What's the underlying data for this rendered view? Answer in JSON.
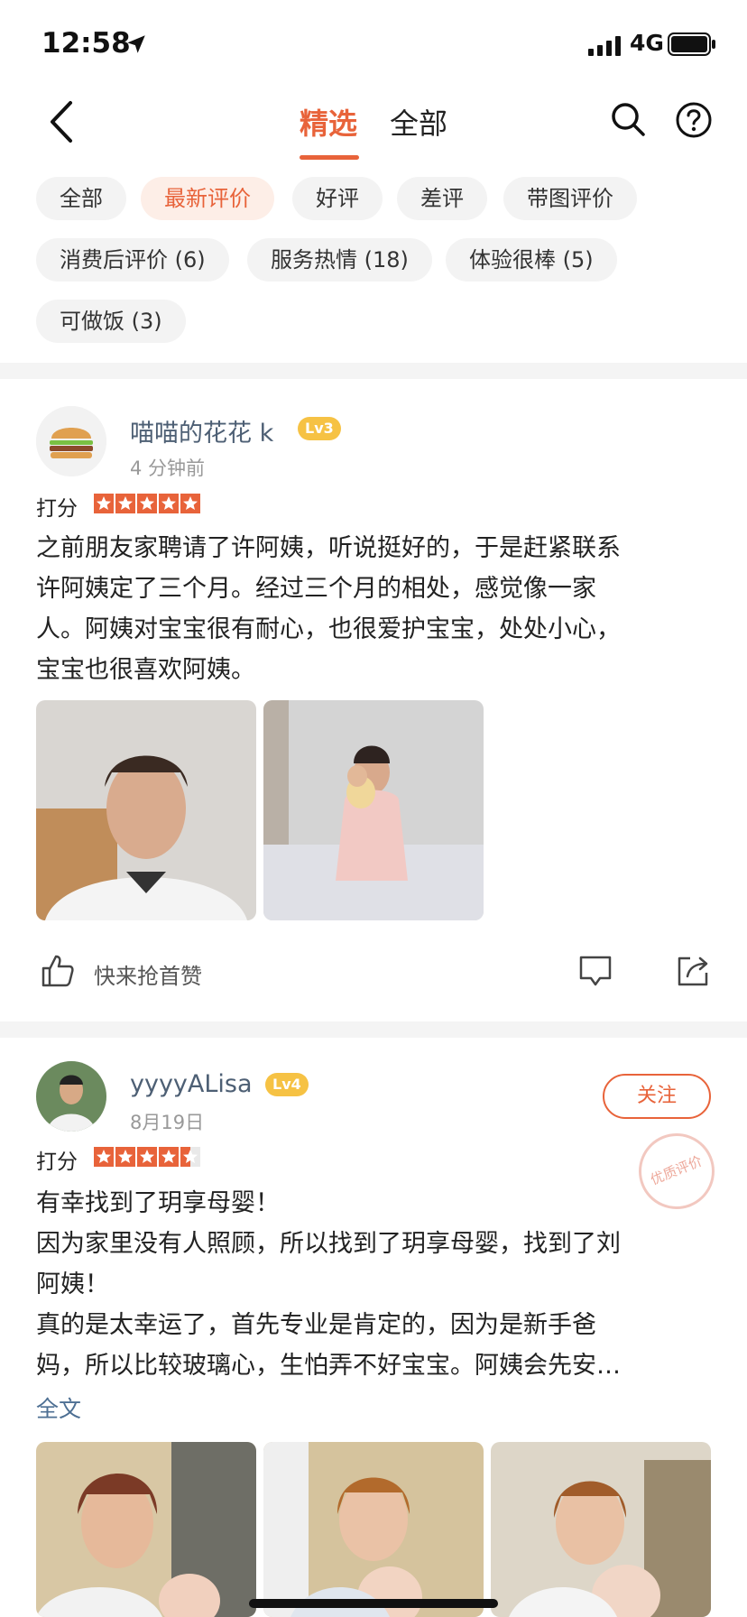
{
  "status_bar": {
    "time": "12:58",
    "network": "4G"
  },
  "header": {
    "tab_selected": "精选",
    "tab_all": "全部"
  },
  "filters": {
    "chips": [
      {
        "label": "全部",
        "active": false
      },
      {
        "label": "最新评价",
        "active": true
      },
      {
        "label": "好评",
        "active": false
      },
      {
        "label": "差评",
        "active": false
      },
      {
        "label": "带图评价",
        "active": false
      },
      {
        "label": "消费后评价 (6)",
        "active": false
      },
      {
        "label": "服务热情 (18)",
        "active": false
      },
      {
        "label": "体验很棒 (5)",
        "active": false
      },
      {
        "label": "可做饭 (3)",
        "active": false
      }
    ]
  },
  "reviews": [
    {
      "username": "喵喵的花花 k",
      "level": "Lv3",
      "time": "4 分钟前",
      "score_label": "打分",
      "rating": 5,
      "text_lines": [
        "之前朋友家聘请了许阿姨，听说挺好的，于是赶紧联系",
        "许阿姨定了三个月。经过三个月的相处，感觉像一家",
        "人。阿姨对宝宝很有耐心，也很爱护宝宝，处处小心，",
        "宝宝也很喜欢阿姨。"
      ],
      "like_label": "快来抢首赞"
    },
    {
      "username": "yyyyALisa",
      "level": "Lv4",
      "time": "8月19日",
      "score_label": "打分",
      "rating": 4.5,
      "follow_label": "关注",
      "stamp_label": "优质评价",
      "text_lines": [
        "有幸找到了玥享母婴！",
        "因为家里没有人照顾，所以找到了玥享母婴，找到了刘",
        "阿姨！",
        "真的是太幸运了，首先专业是肯定的，因为是新手爸",
        "妈，所以比较玻璃心，生怕弄不好宝宝。阿姨会先安…"
      ],
      "full_text_label": "全文"
    }
  ],
  "colors": {
    "accent": "#e8633a",
    "level_badge": "#f6c244",
    "username": "#4d5f74"
  }
}
